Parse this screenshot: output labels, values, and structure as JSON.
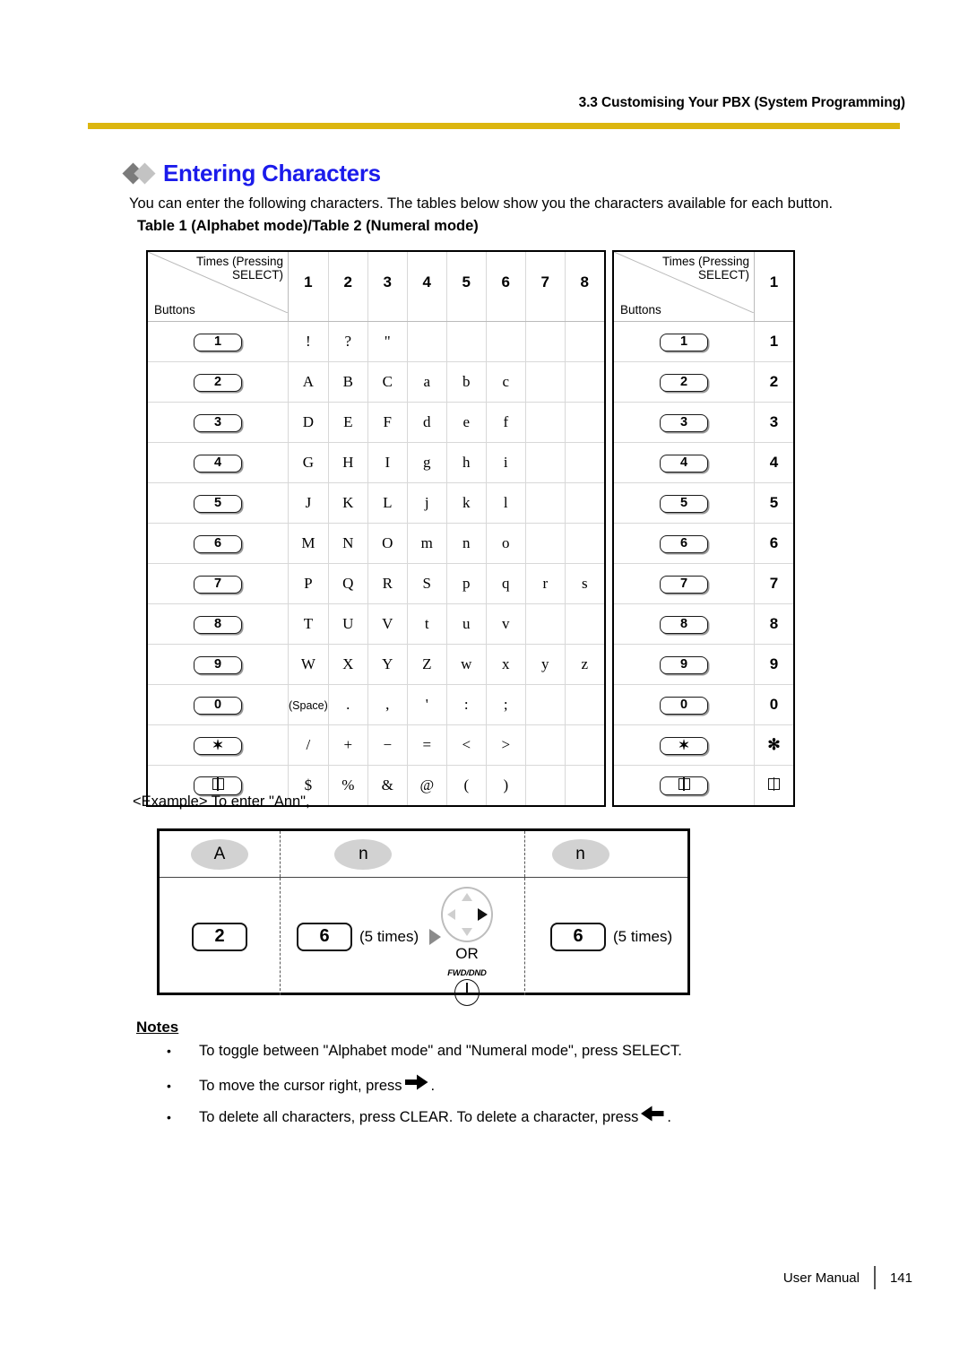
{
  "header": {
    "section_title": "3.3 Customising Your PBX (System Programming)",
    "rule_color": "#dcb60f"
  },
  "heading": {
    "title": "Entering Characters",
    "color": "#1b1beb",
    "diamond_dark": "#7b7b7b",
    "diamond_light": "#c3c3c3"
  },
  "intro": {
    "paragraph": "You can enter the following characters. The tables below show you the characters available for each button.",
    "tables_caption": "Table 1 (Alphabet mode)/Table 2 (Numeral mode)"
  },
  "table_alphabet": {
    "corner_top": "Times (Pressing SELECT)",
    "corner_bottom": "Buttons",
    "columns": [
      "1",
      "2",
      "3",
      "4",
      "5",
      "6",
      "7",
      "8"
    ],
    "rows": [
      {
        "button": "1",
        "button_kind": "digit",
        "chars": [
          "!",
          "?",
          "\"",
          "",
          "",
          "",
          "",
          ""
        ]
      },
      {
        "button": "2",
        "button_kind": "digit",
        "chars": [
          "A",
          "B",
          "C",
          "a",
          "b",
          "c",
          "",
          ""
        ]
      },
      {
        "button": "3",
        "button_kind": "digit",
        "chars": [
          "D",
          "E",
          "F",
          "d",
          "e",
          "f",
          "",
          ""
        ]
      },
      {
        "button": "4",
        "button_kind": "digit",
        "chars": [
          "G",
          "H",
          "I",
          "g",
          "h",
          "i",
          "",
          ""
        ]
      },
      {
        "button": "5",
        "button_kind": "digit",
        "chars": [
          "J",
          "K",
          "L",
          "j",
          "k",
          "l",
          "",
          ""
        ]
      },
      {
        "button": "6",
        "button_kind": "digit",
        "chars": [
          "M",
          "N",
          "O",
          "m",
          "n",
          "o",
          "",
          ""
        ]
      },
      {
        "button": "7",
        "button_kind": "digit",
        "chars": [
          "P",
          "Q",
          "R",
          "S",
          "p",
          "q",
          "r",
          "s"
        ]
      },
      {
        "button": "8",
        "button_kind": "digit",
        "chars": [
          "T",
          "U",
          "V",
          "t",
          "u",
          "v",
          "",
          ""
        ]
      },
      {
        "button": "9",
        "button_kind": "digit",
        "chars": [
          "W",
          "X",
          "Y",
          "Z",
          "w",
          "x",
          "y",
          "z"
        ]
      },
      {
        "button": "0",
        "button_kind": "digit",
        "chars": [
          "(Space)",
          ".",
          ",",
          "'",
          ":",
          ";",
          "",
          ""
        ]
      },
      {
        "button": "✻",
        "button_kind": "star",
        "chars": [
          "/",
          "+",
          "−",
          "=",
          "<",
          ">",
          "",
          ""
        ]
      },
      {
        "button": "#",
        "button_kind": "hash",
        "chars": [
          "$",
          "%",
          "&",
          "@",
          "(",
          ")",
          "",
          ""
        ]
      }
    ]
  },
  "table_numeral": {
    "corner_top": "Times (Pressing SELECT)",
    "corner_bottom": "Buttons",
    "columns": [
      "1"
    ],
    "rows": [
      {
        "button": "1",
        "button_kind": "digit",
        "chars": [
          "1"
        ]
      },
      {
        "button": "2",
        "button_kind": "digit",
        "chars": [
          "2"
        ]
      },
      {
        "button": "3",
        "button_kind": "digit",
        "chars": [
          "3"
        ]
      },
      {
        "button": "4",
        "button_kind": "digit",
        "chars": [
          "4"
        ]
      },
      {
        "button": "5",
        "button_kind": "digit",
        "chars": [
          "5"
        ]
      },
      {
        "button": "6",
        "button_kind": "digit",
        "chars": [
          "6"
        ]
      },
      {
        "button": "7",
        "button_kind": "digit",
        "chars": [
          "7"
        ]
      },
      {
        "button": "8",
        "button_kind": "digit",
        "chars": [
          "8"
        ]
      },
      {
        "button": "9",
        "button_kind": "digit",
        "chars": [
          "9"
        ]
      },
      {
        "button": "0",
        "button_kind": "digit",
        "chars": [
          "0"
        ]
      },
      {
        "button": "✻",
        "button_kind": "star",
        "chars": [
          "✻"
        ]
      },
      {
        "button": "#",
        "button_kind": "hash",
        "chars": [
          "#"
        ]
      }
    ]
  },
  "example": {
    "label": "<Example> To enter \"Ann\",",
    "steps": [
      {
        "result": "A",
        "key": "2",
        "repeat": ""
      },
      {
        "result": "n",
        "key": "6",
        "repeat": "(5 times)"
      },
      {
        "result": "n",
        "key": "6",
        "repeat": "(5 times)"
      }
    ],
    "navigator": {
      "or_label": "OR",
      "fwd_dnd_label": "FWD/DND"
    }
  },
  "notes": {
    "title": "Notes",
    "bullet": "•",
    "items": [
      {
        "text_before": "To toggle between \"Alphabet mode\" and \"Numeral mode\", press SELECT.",
        "icon": "",
        "text_after": ""
      },
      {
        "text_before": "To move the cursor right, press",
        "icon": "right-arrow",
        "text_after": "."
      },
      {
        "text_before": "To delete all characters, press CLEAR. To delete a character, press",
        "icon": "left-arrow",
        "text_after": "."
      }
    ]
  },
  "footer": {
    "manual_label": "User Manual",
    "page_number": "141"
  }
}
